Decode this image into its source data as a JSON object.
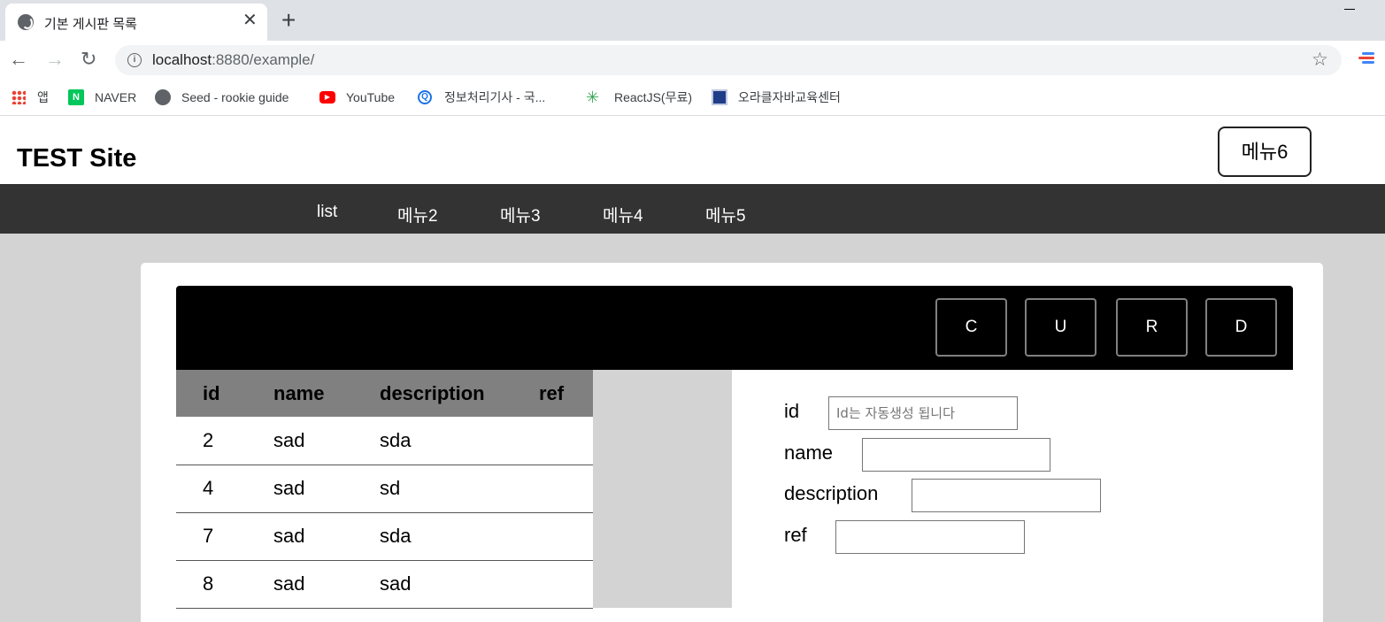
{
  "browser": {
    "tab_title": "기본 게시판 목록",
    "tab_close": "✕",
    "new_tab": "+",
    "url_host": "localhost",
    "url_path": ":8880/example/",
    "bookmarks": [
      {
        "label": "앱",
        "icon": "apps-grid-icon"
      },
      {
        "label": "NAVER",
        "icon": "naver-icon"
      },
      {
        "label": "Seed - rookie guide",
        "icon": "globe-icon"
      },
      {
        "label": "YouTube",
        "icon": "youtube-icon"
      },
      {
        "label": "정보처리기사 - 국...",
        "icon": "search-icon"
      },
      {
        "label": "ReactJS(무료)",
        "icon": "react-icon"
      },
      {
        "label": "오라클자바교육센터",
        "icon": "oracle-java-icon"
      }
    ]
  },
  "site": {
    "title": "TEST Site",
    "menu6": "메뉴6",
    "nav": [
      "list",
      "메뉴2",
      "메뉴3",
      "메뉴4",
      "메뉴5"
    ]
  },
  "crud": {
    "create": "C",
    "update": "U",
    "read": "R",
    "delete": "D"
  },
  "table": {
    "headers": [
      "id",
      "name",
      "description",
      "ref"
    ],
    "rows": [
      {
        "id": "2",
        "name": "sad",
        "description": "sda",
        "ref": ""
      },
      {
        "id": "4",
        "name": "sad",
        "description": "sd",
        "ref": ""
      },
      {
        "id": "7",
        "name": "sad",
        "description": "sda",
        "ref": ""
      },
      {
        "id": "8",
        "name": "sad",
        "description": "sad",
        "ref": ""
      }
    ]
  },
  "form": {
    "id_label": "id",
    "id_placeholder": "Id는 자동생성 됩니다",
    "name_label": "name",
    "description_label": "description",
    "ref_label": "ref"
  },
  "colors": {
    "navbar": "#333333",
    "content_bg": "#d3d3d3",
    "table_header": "#808080",
    "crud_bar": "#000000"
  }
}
